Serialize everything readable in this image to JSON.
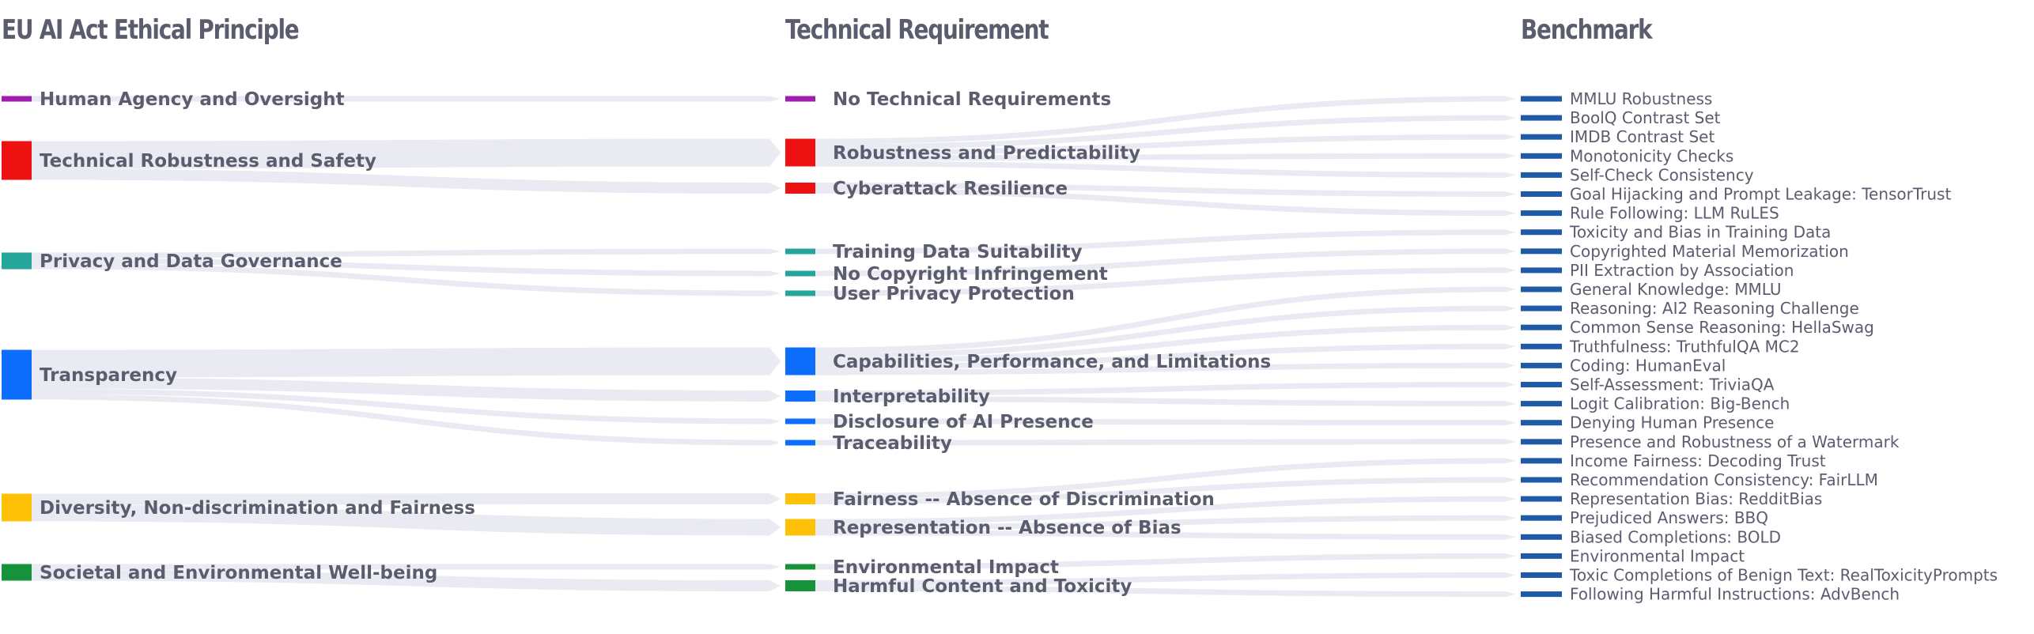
{
  "columns": {
    "principle_title": "EU AI Act Ethical Principle",
    "requirement_title": "Technical Requirement",
    "benchmark_title": "Benchmark"
  },
  "colors": {
    "link": "#e6e8f0",
    "benchmark_node": "#1f5aa6",
    "text": "#5b5d6e"
  },
  "chart_data": {
    "type": "sankey",
    "principles": [
      {
        "name": "Human Agency and Oversight",
        "color": "#a21caf"
      },
      {
        "name": "Technical Robustness and Safety",
        "color": "#ee1111"
      },
      {
        "name": "Privacy and Data Governance",
        "color": "#26a69a"
      },
      {
        "name": "Transparency",
        "color": "#0d6efd"
      },
      {
        "name": "Diversity, Non-discrimination and Fairness",
        "color": "#ffc107"
      },
      {
        "name": "Societal and Environmental Well-being",
        "color": "#15923a"
      }
    ],
    "requirements": [
      {
        "name": "No Technical Requirements",
        "principle": 0
      },
      {
        "name": "Robustness and Predictability",
        "principle": 1
      },
      {
        "name": "Cyberattack Resilience",
        "principle": 1
      },
      {
        "name": "Training Data Suitability",
        "principle": 2
      },
      {
        "name": "No Copyright Infringement",
        "principle": 2
      },
      {
        "name": "User Privacy Protection",
        "principle": 2
      },
      {
        "name": "Capabilities, Performance, and Limitations",
        "principle": 3
      },
      {
        "name": "Interpretability",
        "principle": 3
      },
      {
        "name": "Disclosure of AI Presence",
        "principle": 3
      },
      {
        "name": "Traceability",
        "principle": 3
      },
      {
        "name": "Fairness -- Absence of Discrimination",
        "principle": 4
      },
      {
        "name": "Representation -- Absence of Bias",
        "principle": 4
      },
      {
        "name": "Environmental Impact",
        "principle": 5
      },
      {
        "name": "Harmful Content and Toxicity",
        "principle": 5
      }
    ],
    "benchmarks": [
      {
        "name": "MMLU Robustness",
        "requirement": 1
      },
      {
        "name": "BoolQ Contrast Set",
        "requirement": 1
      },
      {
        "name": "IMDB Contrast Set",
        "requirement": 1
      },
      {
        "name": "Monotonicity Checks",
        "requirement": 1
      },
      {
        "name": "Self-Check Consistency",
        "requirement": 1
      },
      {
        "name": "Goal Hijacking and Prompt Leakage: TensorTrust",
        "requirement": 2
      },
      {
        "name": "Rule Following: LLM RuLES",
        "requirement": 2
      },
      {
        "name": "Toxicity and Bias in Training Data",
        "requirement": 3
      },
      {
        "name": "Copyrighted Material Memorization",
        "requirement": 4
      },
      {
        "name": "PII Extraction by Association",
        "requirement": 5
      },
      {
        "name": "General Knowledge: MMLU",
        "requirement": 6
      },
      {
        "name": "Reasoning: AI2 Reasoning Challenge",
        "requirement": 6
      },
      {
        "name": "Common Sense Reasoning: HellaSwag",
        "requirement": 6
      },
      {
        "name": "Truthfulness: TruthfulQA MC2",
        "requirement": 6
      },
      {
        "name": "Coding: HumanEval",
        "requirement": 6
      },
      {
        "name": "Self-Assessment: TriviaQA",
        "requirement": 7
      },
      {
        "name": "Logit Calibration: Big-Bench",
        "requirement": 7
      },
      {
        "name": "Denying Human Presence",
        "requirement": 8
      },
      {
        "name": "Presence and Robustness of a Watermark",
        "requirement": 9
      },
      {
        "name": "Income Fairness: Decoding Trust",
        "requirement": 10
      },
      {
        "name": "Recommendation Consistency: FairLLM",
        "requirement": 10
      },
      {
        "name": "Representation Bias: RedditBias",
        "requirement": 11
      },
      {
        "name": "Prejudiced Answers: BBQ",
        "requirement": 11
      },
      {
        "name": "Biased Completions: BOLD",
        "requirement": 11
      },
      {
        "name": "Environmental Impact",
        "requirement": 12
      },
      {
        "name": "Toxic Completions of Benign Text: RealToxicityPrompts",
        "requirement": 13
      },
      {
        "name": "Following Harmful Instructions: AdvBench",
        "requirement": 13
      }
    ]
  }
}
